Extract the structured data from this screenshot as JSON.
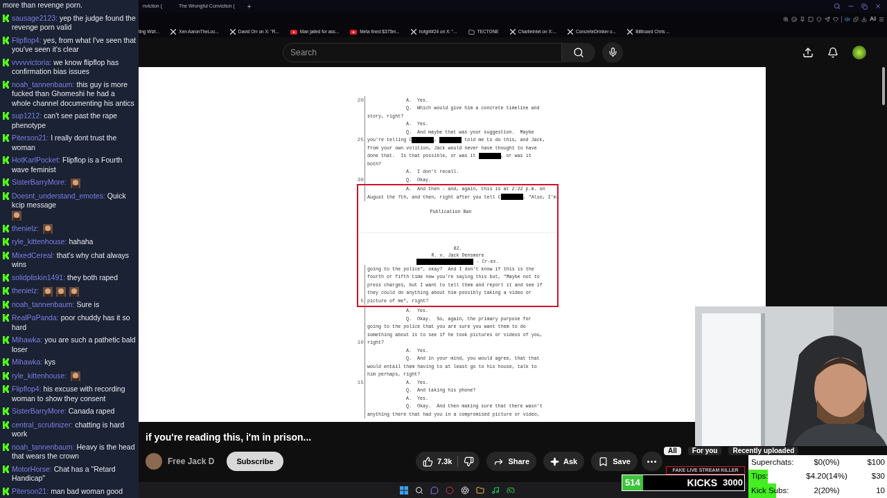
{
  "chat": {
    "messages": [
      {
        "kind": "continuation",
        "text": "more than revenge porn."
      },
      {
        "kind": "message",
        "user": "sausage2123:",
        "text": "yep the judge found the revenge porn valid"
      },
      {
        "kind": "message",
        "user": "Flipflop4:",
        "text": "yes, from what I've seen that you've seen it's clear"
      },
      {
        "kind": "message",
        "user": "vvvvvictoria:",
        "text": "we know flipflop has confirmation bias issues"
      },
      {
        "kind": "message",
        "user": "noah_tannenbaum:",
        "text": "this guy is more fucked than Ghomeshi he had a whole channel documenting his antics"
      },
      {
        "kind": "message",
        "user": "sup1212:",
        "text": "can't see past the rape phenotype"
      },
      {
        "kind": "message",
        "user": "Piterson21:",
        "text": "I really dont trust the woman"
      },
      {
        "kind": "message",
        "user": "HotKarlPocket:",
        "text": "Flipflop is a Fourth wave feminist"
      },
      {
        "kind": "message",
        "user": "SisterBarryMore:",
        "emotes": [
          {
            "kind": "emote"
          }
        ]
      },
      {
        "kind": "message",
        "user": "Doesnt_understand_emotes:",
        "text": "Quick kcip message",
        "emotes": [
          {
            "kind": "emote"
          }
        ]
      },
      {
        "kind": "message",
        "user": "thenielz:",
        "emotes": [
          {
            "kind": "emote"
          }
        ]
      },
      {
        "kind": "message",
        "user": "ryle_kittenhouse:",
        "text": "hahaha"
      },
      {
        "kind": "message",
        "user": "MixedCereal:",
        "text": "that's why chat always wins"
      },
      {
        "kind": "message",
        "user": "solidpliskin1491:",
        "text": "they both raped"
      },
      {
        "kind": "message",
        "user": "thenielz:",
        "emotes": [
          {
            "kind": "emote"
          },
          {
            "kind": "emote"
          },
          {
            "kind": "emote"
          }
        ]
      },
      {
        "kind": "message",
        "user": "noah_tannenbaum:",
        "text": "Sure is"
      },
      {
        "kind": "message",
        "user": "RealPaPanda:",
        "text": "poor chuddy has it so hard"
      },
      {
        "kind": "message",
        "user": "Mihawka:",
        "text": "you are such a pathetic bald loser"
      },
      {
        "kind": "message",
        "user": "Mihawka:",
        "text": "kys"
      },
      {
        "kind": "message",
        "user": "ryle_kittenhouse:",
        "emotes": [
          {
            "kind": "emote"
          }
        ]
      },
      {
        "kind": "message",
        "user": "Flipflop4:",
        "text": "his excuse with recording woman to show they consent"
      },
      {
        "kind": "message",
        "user": "SisterBarryMore:",
        "text": "Canada raped"
      },
      {
        "kind": "message",
        "user": "central_scrutinizer:",
        "text": "chatting is hard work"
      },
      {
        "kind": "message",
        "user": "noah_tannenbaum:",
        "text": "Heavy is the head that wears the crown"
      },
      {
        "kind": "message",
        "user": "MotorHorse:",
        "text": "Chat has a \"Retard Handicap\""
      },
      {
        "kind": "message",
        "user": "Piterson21:",
        "text": "man bad woman good"
      }
    ]
  },
  "browser": {
    "tabs": [
      {
        "label": "nviction ("
      },
      {
        "label": "The Wrongful Conviction ("
      }
    ],
    "new_tab": "+",
    "ai_label": "AI",
    "bookmarks": [
      {
        "kind": "plain",
        "label": "ting Wizt..."
      },
      {
        "kind": "x",
        "label": "Xen AaronTheLoc..."
      },
      {
        "kind": "x",
        "label": "David Orr on X: \"R..."
      },
      {
        "kind": "youtube",
        "label": "Man jailed for ass..."
      },
      {
        "kind": "youtube",
        "label": "Meta fined $375m..."
      },
      {
        "kind": "x",
        "label": "hotgirl#24 on X: \"..."
      },
      {
        "kind": "folder",
        "label": "TECTONE"
      },
      {
        "kind": "x",
        "label": "CharlieIntel on X:..."
      },
      {
        "kind": "x",
        "label": "ConcreteDrinker o..."
      },
      {
        "kind": "x",
        "label": "Billboard Chris ..."
      }
    ]
  },
  "header": {
    "search": {
      "placeholder": "Search"
    }
  },
  "document": {
    "lines": [
      {
        "kind": "qa",
        "num": "20",
        "text": "A.  Yes.",
        "highlighted": false
      },
      {
        "kind": "qa",
        "text": "Q.  Which would give him a concrete timeline and",
        "highlighted": false
      },
      {
        "kind": "cont",
        "text": "story, right?",
        "highlighted": false
      },
      {
        "kind": "qa",
        "text": "A.  Yes.",
        "highlighted": false
      },
      {
        "kind": "qa",
        "text": "Q.  And maybe that was your suggestion.  Maybe",
        "highlighted": false
      },
      {
        "kind": "cont",
        "num": "25",
        "segments": [
          {
            "kind": "text",
            "text": "you're telling C"
          },
          {
            "kind": "redaction"
          },
          {
            "kind": "text",
            "text": ", "
          },
          {
            "kind": "redaction"
          },
          {
            "kind": "text",
            "text": " told me to do this, and Jack,"
          }
        ],
        "highlighted": false
      },
      {
        "kind": "cont",
        "text": "from your own volition, Jack would never have thought to have",
        "highlighted": false
      },
      {
        "kind": "cont",
        "segments": [
          {
            "kind": "text",
            "text": "done that.  Is that possible, or was it "
          },
          {
            "kind": "redaction"
          },
          {
            "kind": "text",
            "text": ", or was it"
          }
        ],
        "highlighted": false
      },
      {
        "kind": "cont",
        "text": "both?",
        "highlighted": false
      },
      {
        "kind": "qa",
        "text": "A.  I don't recall.",
        "highlighted": false
      },
      {
        "kind": "qa",
        "num": "30",
        "text": "Q.  Okay.",
        "highlighted": false
      },
      {
        "kind": "qa",
        "text": "A.  And then - and, again, this is at 2:22 p.m. on",
        "highlighted": true
      },
      {
        "kind": "cont",
        "segments": [
          {
            "kind": "text",
            "text": "August the 7th, and then, right after you tell C"
          },
          {
            "kind": "redaction"
          },
          {
            "kind": "text",
            "text": ", \"Also, I'm"
          }
        ],
        "highlighted": true
      },
      {
        "kind": "footer",
        "text": "Publication Ban",
        "highlighted": true
      },
      {
        "kind": "page_break",
        "highlighted": true
      },
      {
        "kind": "header",
        "text": "82.",
        "highlighted": true
      },
      {
        "kind": "header",
        "text": "R. v. Jack Densmore",
        "highlighted": true
      },
      {
        "kind": "header",
        "segments": [
          {
            "kind": "redaction"
          },
          {
            "kind": "text",
            "text": " - Cr-ex."
          }
        ],
        "highlighted": true
      },
      {
        "kind": "cont",
        "text": "going to the police\", okay?  And I don't know if this is the",
        "highlighted": true
      },
      {
        "kind": "cont",
        "text": "fourth or fifth time now you're saying this but, \"Maybe not to",
        "highlighted": true
      },
      {
        "kind": "cont",
        "text": "press charges, but I want to tell them and report it and see if",
        "highlighted": true
      },
      {
        "kind": "cont",
        "text": "they could do anything about him possibly taking a video or",
        "highlighted": true
      },
      {
        "kind": "cont",
        "num": "5",
        "text": "picture of me\", right?",
        "highlighted": true
      },
      {
        "kind": "qa",
        "text": "A.  Yes.",
        "highlighted": false
      },
      {
        "kind": "qa",
        "text": "Q.  Okay.  So, again, the primary purpose for",
        "highlighted": false
      },
      {
        "kind": "cont",
        "text": "going to the police that you are sure you want them to do",
        "highlighted": false
      },
      {
        "kind": "cont",
        "text": "something about is to see if he took pictures or videos of you,",
        "highlighted": false
      },
      {
        "kind": "cont",
        "num": "10",
        "text": "right?",
        "highlighted": false
      },
      {
        "kind": "qa",
        "text": "A.  Yes.",
        "highlighted": false
      },
      {
        "kind": "qa",
        "text": "Q.  And in your mind, you would agree, that that",
        "highlighted": false
      },
      {
        "kind": "cont",
        "text": "would entail them having to at least go to his house, talk to",
        "highlighted": false
      },
      {
        "kind": "cont",
        "text": "him perhaps, right?",
        "highlighted": false
      },
      {
        "kind": "qa",
        "num": "15",
        "text": "A.  Yes.",
        "highlighted": false
      },
      {
        "kind": "qa",
        "text": "Q.  And taking his phone?",
        "highlighted": false
      },
      {
        "kind": "qa",
        "text": "A.  Yes.",
        "highlighted": false
      },
      {
        "kind": "qa",
        "text": "Q.  Okay.  And then making sure that there wasn't",
        "highlighted": false
      },
      {
        "kind": "cont",
        "text": "anything there that had you in a compromised picture or video,",
        "highlighted": false
      }
    ]
  },
  "video": {
    "title": "if you're reading this, i'm in prison...",
    "channel": "Free Jack D",
    "subscribe": "Subscribe",
    "likes": "7.3k",
    "share": "Share",
    "ask": "Ask",
    "save": "Save"
  },
  "chips": [
    {
      "label": "All",
      "selected": true
    },
    {
      "label": "For you",
      "selected": false
    },
    {
      "label": "Recently uploaded",
      "selected": false
    }
  ],
  "kicks_bar": {
    "label": "FAKE LIVE STREAM KILLER",
    "count": "514",
    "name": "KICKS",
    "goal": "3000",
    "level": 0.17
  },
  "goals": [
    {
      "label": "Superchats:",
      "value": "$0(0%)",
      "goal": "$100"
    },
    {
      "label": "Tips:",
      "value": "$4.20(14%)",
      "goal": "$30",
      "level": 0.14
    },
    {
      "label": "Kick Subs:",
      "value": "2(20%)",
      "goal": "10",
      "level": 0.2
    }
  ]
}
